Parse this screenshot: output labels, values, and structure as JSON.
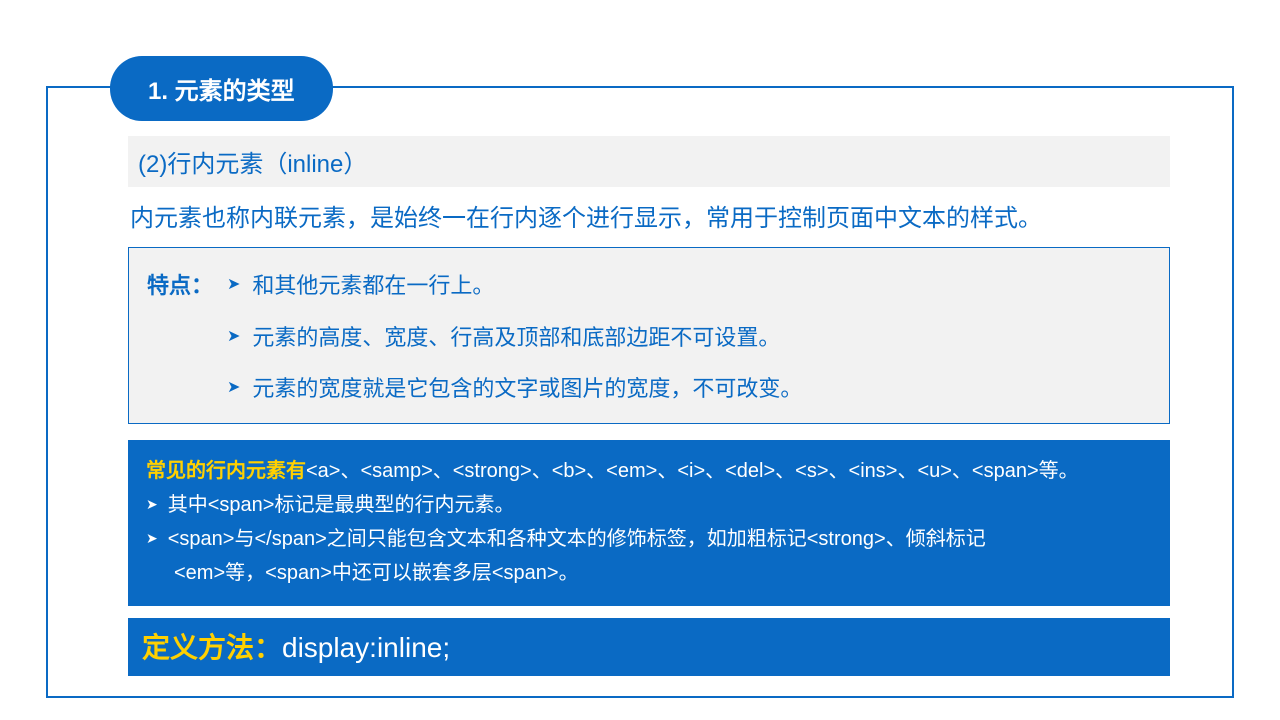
{
  "title": "1. 元素的类型",
  "section_header": "(2)行内元素（inline）",
  "intro": "内元素也称内联元素，是始终一在行内逐个进行显示，常用于控制页面中文本的样式。",
  "features_label": "特点：",
  "features": [
    "和其他元素都在一行上。",
    "元素的高度、宽度、行高及顶部和底部边距不可设置。",
    "元素的宽度就是它包含的文字或图片的宽度，不可改变。"
  ],
  "common_label": "常见的行内元素有",
  "common_text": "<a>、<samp>、<strong>、<b>、<em>、<i>、<del>、<s>、<ins>、<u>、<span>等。",
  "note1": "其中<span>标记是最典型的行内元素。",
  "note2a": "<span>与</span>之间只能包含文本和各种文本的修饰标签，如加粗标记<strong>、倾斜标记",
  "note2b": "<em>等，<span>中还可以嵌套多层<span>。",
  "def_label": "定义方法：",
  "def_value": "display:inline;"
}
